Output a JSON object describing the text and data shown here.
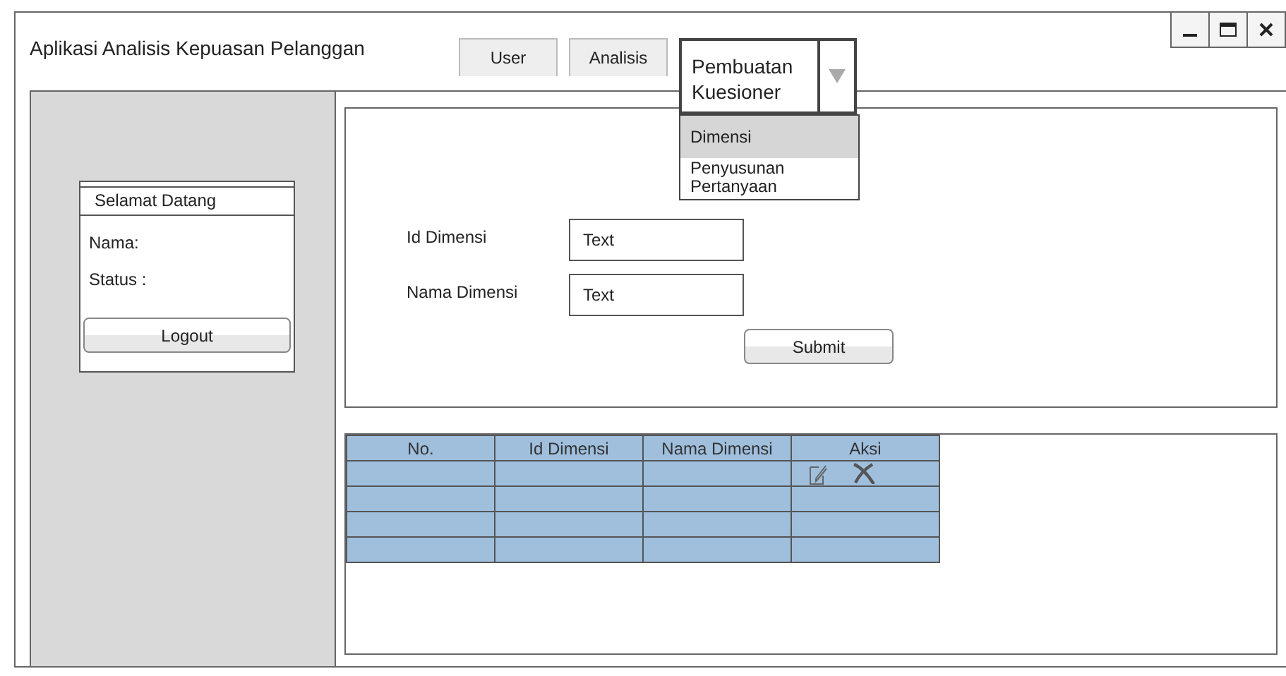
{
  "window": {
    "title": "Aplikasi Analisis Kepuasan Pelanggan",
    "controls": [
      {
        "kind": "minimize"
      },
      {
        "kind": "maximize"
      },
      {
        "kind": "close"
      }
    ]
  },
  "tabs": [
    {
      "label": "User",
      "kind": "tab",
      "selected": false
    },
    {
      "label": "Analisis",
      "kind": "tab",
      "selected": false
    },
    {
      "label": "Pembuatan Kuesioner",
      "kind": "dropdown",
      "selected": true
    }
  ],
  "dropdown_menu": [
    {
      "label": "Dimensi",
      "selected": true
    },
    {
      "label": "Penyusunan Pertanyaan",
      "selected": false
    }
  ],
  "welcome": {
    "title": "Selamat Datang",
    "fields": [
      "Nama:",
      "Status :"
    ],
    "button": "Logout"
  },
  "form": {
    "fields": [
      {
        "label": "Id Dimensi",
        "value": "Text"
      },
      {
        "label": "Nama Dimensi",
        "value": "Text"
      }
    ],
    "submit": "Submit"
  },
  "table": {
    "columns": [
      "No.",
      "Id Dimensi",
      "Nama Dimensi",
      "Aksi"
    ],
    "rows": [
      {
        "kind": "actions"
      },
      {
        "kind": "blank"
      },
      {
        "kind": "blank"
      },
      {
        "kind": "blank"
      }
    ]
  }
}
